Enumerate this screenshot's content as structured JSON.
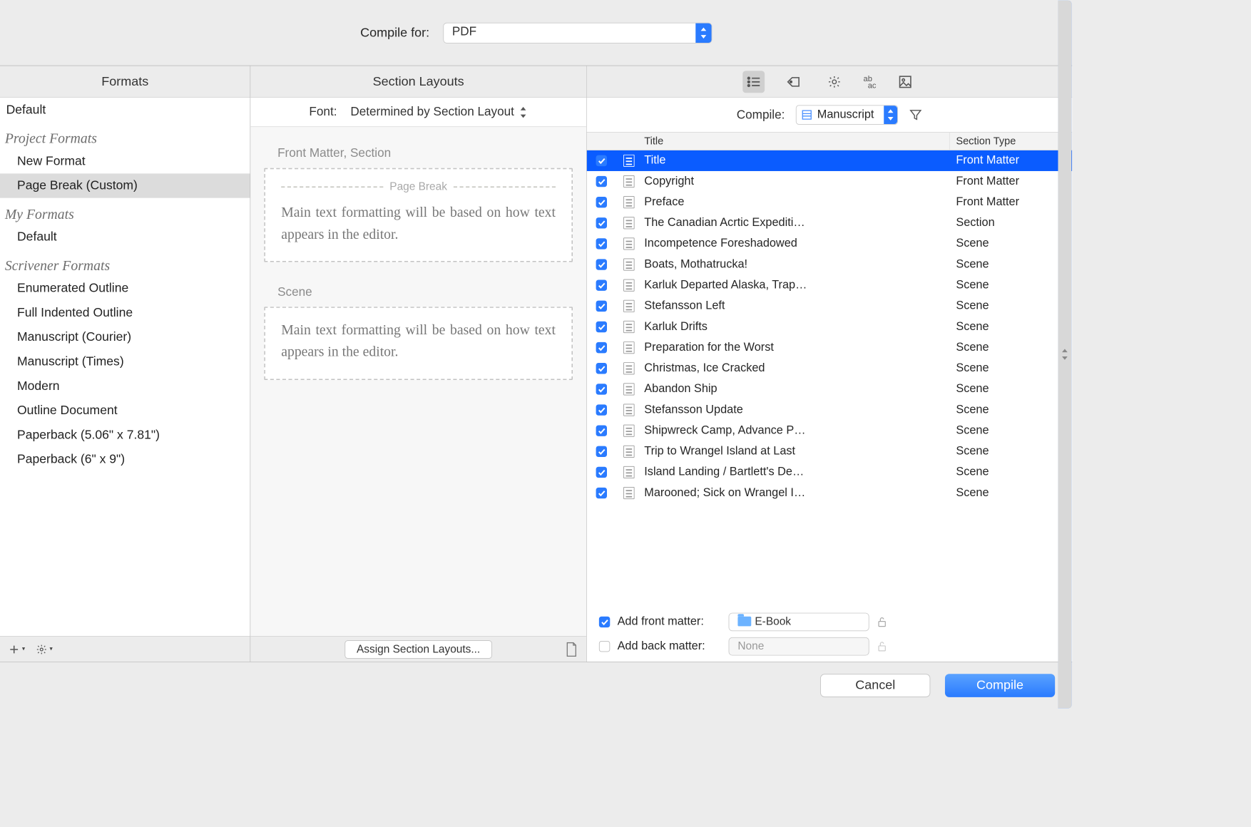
{
  "topbar": {
    "label": "Compile for:",
    "format": "PDF"
  },
  "columns": {
    "formats": "Formats",
    "layouts": "Section Layouts"
  },
  "formats": {
    "top0": "Default",
    "group1": "Project Formats",
    "g1_0": "New Format",
    "g1_1": "Page Break (Custom)",
    "group2": "My Formats",
    "g2_0": "Default",
    "group3": "Scrivener Formats",
    "g3_0": "Enumerated Outline",
    "g3_1": "Full Indented Outline",
    "g3_2": "Manuscript (Courier)",
    "g3_3": "Manuscript (Times)",
    "g3_4": "Modern",
    "g3_5": "Outline Document",
    "g3_6": "Paperback (5.06\" x 7.81\")",
    "g3_7": "Paperback (6\" x 9\")"
  },
  "fontrow": {
    "label": "Font:",
    "value": "Determined by Section Layout"
  },
  "layouts": {
    "s0_label": "Front Matter, Section",
    "pageBreak": "Page Break",
    "bodytext": "Main text formatting will be based on how text appears in the editor.",
    "s1_label": "Scene",
    "assign": "Assign Section Layouts..."
  },
  "right": {
    "compileLabel": "Compile:",
    "compileTarget": "Manuscript",
    "header_title": "Title",
    "header_type": "Section Type"
  },
  "docs": [
    {
      "title": "Title",
      "type": "Front Matter",
      "checked": true,
      "selected": true
    },
    {
      "title": "Copyright",
      "type": "Front Matter",
      "checked": true
    },
    {
      "title": "Preface",
      "type": "Front Matter",
      "checked": true
    },
    {
      "title": "The Canadian Acrtic Expediti…",
      "type": "Section",
      "checked": true
    },
    {
      "title": "Incompetence Foreshadowed",
      "type": "Scene",
      "checked": true
    },
    {
      "title": "Boats, Mothatrucka!",
      "type": "Scene",
      "checked": true
    },
    {
      "title": "Karluk Departed Alaska, Trap…",
      "type": "Scene",
      "checked": true
    },
    {
      "title": "Stefansson Left",
      "type": "Scene",
      "checked": true
    },
    {
      "title": "Karluk Drifts",
      "type": "Scene",
      "checked": true
    },
    {
      "title": "Preparation for the Worst",
      "type": "Scene",
      "checked": true
    },
    {
      "title": "Christmas, Ice Cracked",
      "type": "Scene",
      "checked": true
    },
    {
      "title": "Abandon Ship",
      "type": "Scene",
      "checked": true
    },
    {
      "title": "Stefansson Update",
      "type": "Scene",
      "checked": true
    },
    {
      "title": "Shipwreck Camp, Advance P…",
      "type": "Scene",
      "checked": true
    },
    {
      "title": "Trip to Wrangel Island at Last",
      "type": "Scene",
      "checked": true
    },
    {
      "title": "Island Landing / Bartlett's De…",
      "type": "Scene",
      "checked": true
    },
    {
      "title": "Marooned; Sick on Wrangel I…",
      "type": "Scene",
      "checked": true
    }
  ],
  "matter": {
    "frontLabel": "Add front matter:",
    "frontValue": "E-Book",
    "backLabel": "Add back matter:",
    "backValue": "None"
  },
  "buttons": {
    "cancel": "Cancel",
    "compile": "Compile"
  }
}
